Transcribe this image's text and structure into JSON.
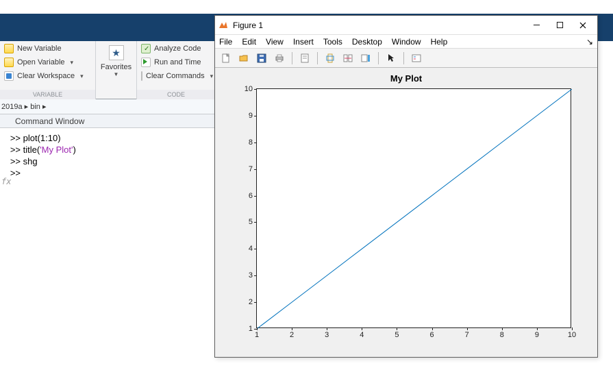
{
  "desktop": {
    "toolstrip": {
      "variable_section": {
        "label": "VARIABLE",
        "new_variable": "New Variable",
        "open_variable": "Open Variable",
        "clear_workspace": "Clear Workspace"
      },
      "favorites_section": {
        "label": "Favorites"
      },
      "code_section": {
        "label": "CODE",
        "analyze": "Analyze Code",
        "run_time": "Run and Time",
        "clear_commands": "Clear Commands"
      }
    },
    "path": "2019a ▸ bin ▸",
    "command_window": {
      "title": "Command Window",
      "lines": [
        {
          "prompt": ">> ",
          "code": "plot(1:10)",
          "str": ""
        },
        {
          "prompt": ">> ",
          "code": "title(",
          "str": "'My Plot'",
          "tail": ")"
        },
        {
          "prompt": ">> ",
          "code": "shg",
          "str": ""
        },
        {
          "prompt": ">> ",
          "code": "",
          "str": ""
        }
      ]
    }
  },
  "figure": {
    "title": "Figure 1",
    "menus": [
      "File",
      "Edit",
      "View",
      "Insert",
      "Tools",
      "Desktop",
      "Window",
      "Help"
    ],
    "toolbar_icons": [
      "new-file-icon",
      "open-file-icon",
      "save-icon",
      "print-icon",
      "page-setup-icon",
      "data-cursor-icon",
      "link-icon",
      "colorbar-icon",
      "pointer-icon",
      "rotate-icon"
    ]
  },
  "chart_data": {
    "type": "line",
    "title": "My Plot",
    "x": [
      1,
      2,
      3,
      4,
      5,
      6,
      7,
      8,
      9,
      10
    ],
    "y": [
      1,
      2,
      3,
      4,
      5,
      6,
      7,
      8,
      9,
      10
    ],
    "xlim": [
      1,
      10
    ],
    "ylim": [
      1,
      10
    ],
    "xticks": [
      1,
      2,
      3,
      4,
      5,
      6,
      7,
      8,
      9,
      10
    ],
    "yticks": [
      1,
      2,
      3,
      4,
      5,
      6,
      7,
      8,
      9,
      10
    ],
    "line_color": "#0072bd"
  }
}
